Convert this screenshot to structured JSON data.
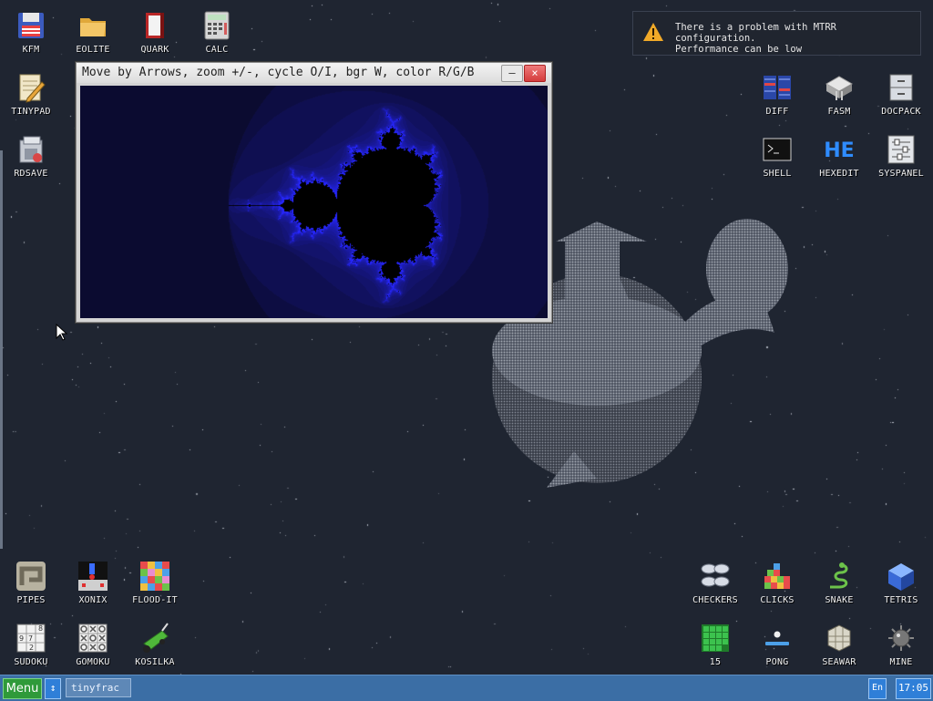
{
  "notification": {
    "line1": "There is a problem with MTRR configuration.",
    "line2": "Performance can be low",
    "icon": "warning-icon"
  },
  "window": {
    "title": "Move by Arrows, zoom +/-, cycle O/I, bgr W, color R/G/B",
    "minimize_label": "–",
    "close_label": "×"
  },
  "desktop_icons": {
    "kfm": "KFM",
    "eolite": "EOLITE",
    "quark": "QUARK",
    "calc": "CALC",
    "tinypad": "TINYPAD",
    "rdsave": "RDSAVE",
    "diff": "DIFF",
    "fasm": "FASM",
    "docpack": "DOCPACK",
    "shell": "SHELL",
    "hexedit": "HEXEDIT",
    "syspanel": "SYSPANEL",
    "pipes": "PIPES",
    "xonix": "XONIX",
    "floodit": "FLOOD-IT",
    "sudoku": "SUDOKU",
    "gomoku": "GOMOKU",
    "kosilka": "KOSILKA",
    "checkers": "CHECKERS",
    "clicks": "CLICKS",
    "snake": "SNAKE",
    "tetris": "TETRIS",
    "n15": "15",
    "pong": "PONG",
    "seawar": "SEAWAR",
    "mine": "MINE"
  },
  "taskbar": {
    "menu_label": "Menu",
    "task_item": "tinyfrac",
    "language": "En",
    "clock": "17:05"
  },
  "colors": {
    "desktop": "#1f2531",
    "taskbar": "#3b6ea5",
    "menu_button": "#2f9a3a",
    "fractal_glow": "#2626ff"
  }
}
